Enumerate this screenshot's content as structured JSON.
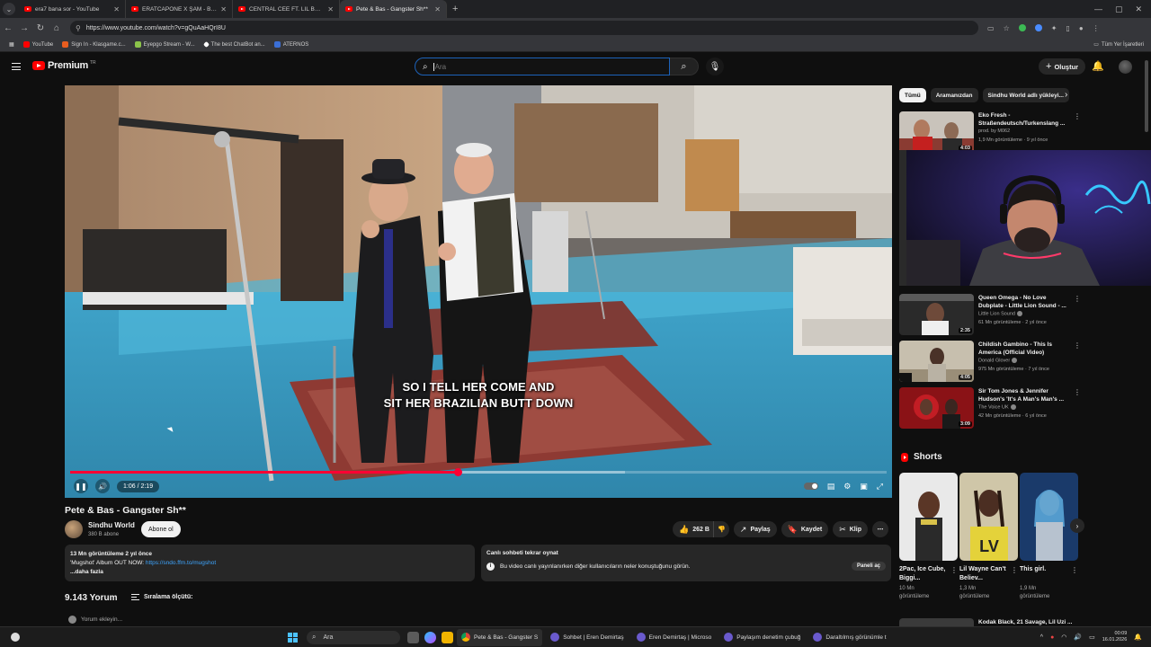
{
  "browser": {
    "tabs": [
      {
        "title": "era7 bana sor - YouTube",
        "active": false
      },
      {
        "title": "ERATCAPONE X ŞAM - BANA S...",
        "active": false
      },
      {
        "title": "CENTRAL CEE FT. LIL BABY - BA...",
        "active": false
      },
      {
        "title": "Pete & Bas - Gangster Sh**",
        "active": true
      }
    ],
    "url": "https://www.youtube.com/watch?v=gQuAaHQrI8U",
    "bookmarks": [
      "YouTube",
      "Sign In - Klasgame.c...",
      "Eyepgo Stream - W...",
      "The best ChatBot an...",
      "ATERNOS"
    ],
    "bookmarks_right": "Tüm Yer İşaretleri"
  },
  "header": {
    "logo_text": "Premium",
    "logo_tm": "TR",
    "search_placeholder": "Ara",
    "create_label": "Oluştur"
  },
  "player": {
    "caption_line1": "SO I TELL HER COME AND",
    "caption_line2": "SIT HER BRAZILIAN BUTT DOWN",
    "time": "1:06 / 2:19",
    "progress": 0.475,
    "buffered": 0.68
  },
  "video": {
    "title": "Pete & Bas - Gangster Sh**",
    "channel": "Sindhu World",
    "subscribers": "380 B abone",
    "subscribe_label": "Abone ol",
    "likes": "262 B",
    "share_label": "Paylaş",
    "save_label": "Kaydet",
    "clip_label": "Klip",
    "desc_stats": "13 Mn görüntüleme  2 yıl önce",
    "desc_line2": "'Mugshot' Album OUT NOW: ",
    "desc_link": "https://sndo.ffm.to/mugshot",
    "desc_more": "...daha fazla",
    "live_title": "Canlı sohbeti tekrar oynat",
    "live_text": "Bu video canlı yayınlanırken diğer kullanıcıların neler konuştuğunu görün.",
    "live_button": "Paneli aç",
    "comments_count": "9.143 Yorum",
    "sort_label": "Sıralama ölçütü:",
    "add_comment": "Yorum ekleyin..."
  },
  "sidebar": {
    "chips": [
      "Tümü",
      "Aramanızdan",
      "Sindhu World adlı yükleyi..."
    ],
    "recommendations": [
      {
        "title": "Eko Fresh - Straßendeutsch/Turkenslang ...",
        "channel": "prod. by M062",
        "meta": "1,9 Mn görüntüleme · 9 yıl önce",
        "duration": "4:03",
        "verified": false
      },
      {
        "title": "Queen Omega - No Love Dubplate - Little Lion Sound - ...",
        "channel": "Little Lion Sound",
        "meta": "61 Mn görüntüleme · 2 yıl önce",
        "duration": "2:35",
        "verified": true
      },
      {
        "title": "Childish Gambino - This Is America (Official Video)",
        "channel": "Donald Glover",
        "meta": "975 Mn görüntüleme · 7 yıl önce",
        "duration": "4:05",
        "verified": true
      },
      {
        "title": "Sir Tom Jones & Jennifer Hudson's 'It's A Man's Man's ...",
        "channel": "The Voice UK",
        "meta": "42 Mn görüntüleme · 6 yıl önce",
        "duration": "3:09",
        "verified": true
      }
    ],
    "shorts_heading": "Shorts",
    "shorts": [
      {
        "title": "2Pac, Ice Cube, Biggi...",
        "views": "10 Mn görüntüleme"
      },
      {
        "title": "Lil Wayne Can't Believ...",
        "views": "1,3 Mn görüntüleme"
      },
      {
        "title": "This girl.",
        "views": "1,9 Mn görüntüleme"
      }
    ],
    "peek_title": "Kodak Black, 21 Savage, Lil Uzi ..."
  },
  "taskbar": {
    "search_label": "Ara",
    "apps": [
      {
        "label": "Pete & Bas - Gangster S",
        "color": "#e8453c",
        "active": true
      },
      {
        "label": "Sohbet | Eren Demirtaş",
        "color": "#6a5acd",
        "active": false
      },
      {
        "label": "Eren Demirtaş | Microso",
        "color": "#6a5acd",
        "active": false
      },
      {
        "label": "Paylaşım denetim çubuğ",
        "color": "#6a5acd",
        "active": false
      },
      {
        "label": "Daraltılmış görünümle t",
        "color": "#6a5acd",
        "active": false
      }
    ],
    "time": "00:09",
    "date": "16.01.2026"
  }
}
